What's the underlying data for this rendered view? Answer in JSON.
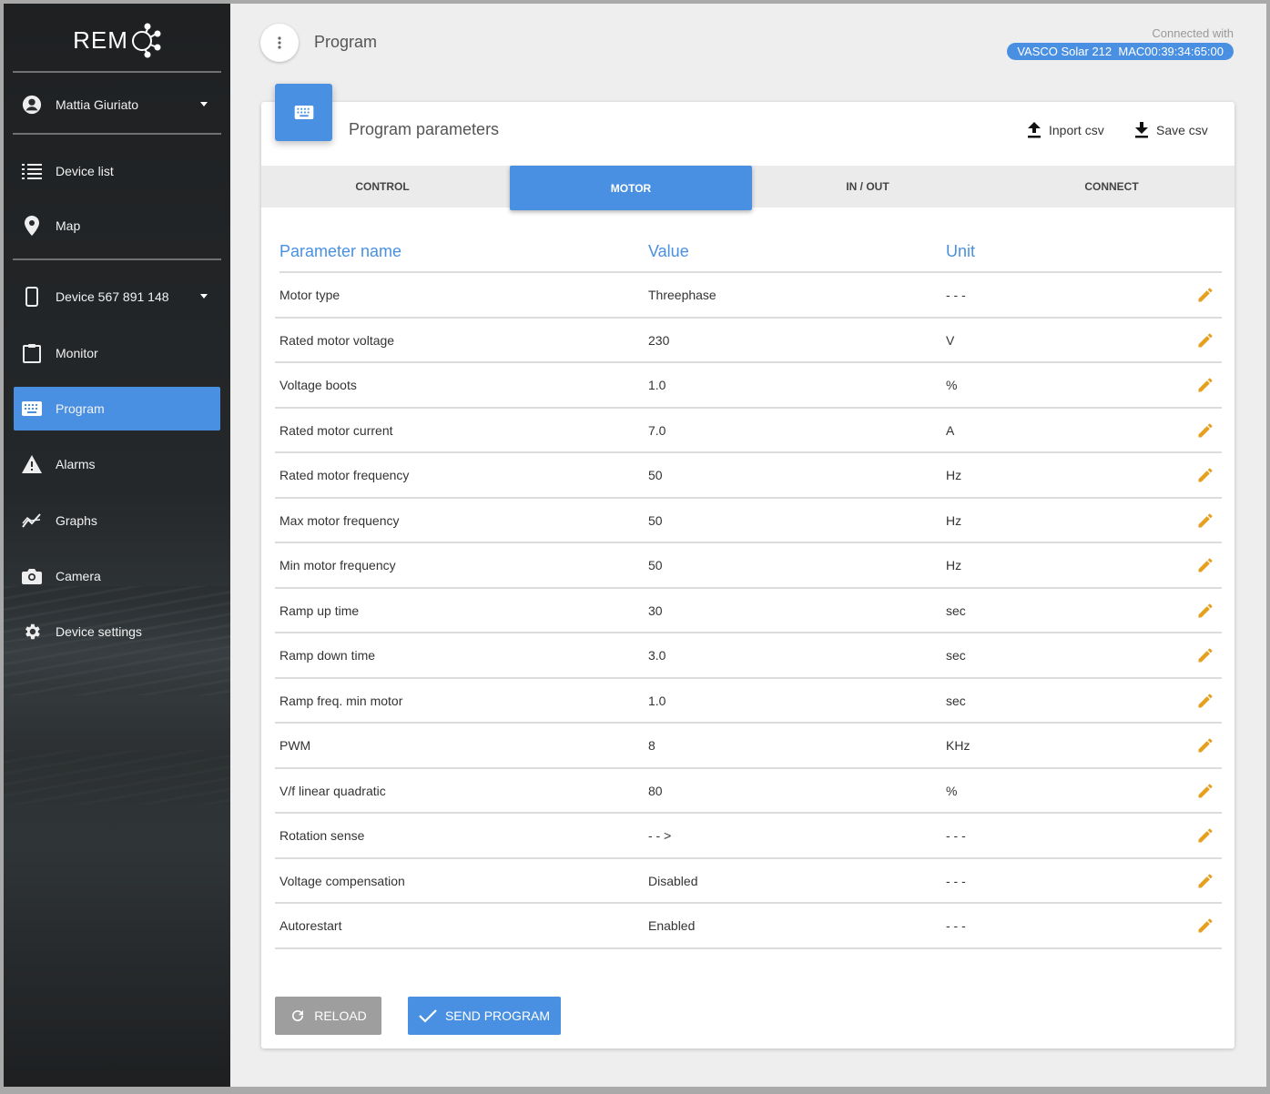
{
  "app": {
    "logo_text": "REM"
  },
  "sidebar": {
    "user": "Mattia Giuriato",
    "items": [
      {
        "label": "Device list"
      },
      {
        "label": "Map"
      },
      {
        "label": "Device 567 891 148"
      },
      {
        "label": "Monitor"
      },
      {
        "label": "Program"
      },
      {
        "label": "Alarms"
      },
      {
        "label": "Graphs"
      },
      {
        "label": "Camera"
      },
      {
        "label": "Device settings"
      }
    ]
  },
  "header": {
    "title": "Program",
    "connected_label": "Connected with",
    "connected_device": "VASCO Solar 212  MAC00:39:34:65:00"
  },
  "card": {
    "title": "Program parameters",
    "import_label": "Inport csv",
    "save_label": "Save csv",
    "tabs": [
      "CONTROL",
      "MOTOR",
      "IN / OUT",
      "CONNECT"
    ],
    "active_tab": "MOTOR",
    "columns": {
      "name": "Parameter name",
      "value": "Value",
      "unit": "Unit"
    },
    "rows": [
      {
        "name": "Motor type",
        "value": "Threephase",
        "unit": "- - -"
      },
      {
        "name": "Rated motor voltage",
        "value": "230",
        "unit": "V"
      },
      {
        "name": "Voltage boots",
        "value": "1.0",
        "unit": "%"
      },
      {
        "name": "Rated motor current",
        "value": "7.0",
        "unit": "A"
      },
      {
        "name": "Rated motor frequency",
        "value": "50",
        "unit": "Hz"
      },
      {
        "name": "Max motor frequency",
        "value": "50",
        "unit": "Hz"
      },
      {
        "name": "Min motor frequency",
        "value": "50",
        "unit": "Hz"
      },
      {
        "name": "Ramp up time",
        "value": "30",
        "unit": "sec"
      },
      {
        "name": "Ramp down time",
        "value": "3.0",
        "unit": "sec"
      },
      {
        "name": "Ramp freq. min motor",
        "value": "1.0",
        "unit": "sec"
      },
      {
        "name": "PWM",
        "value": "8",
        "unit": "KHz"
      },
      {
        "name": "V/f linear quadratic",
        "value": "80",
        "unit": "%"
      },
      {
        "name": "Rotation sense",
        "value": "- - >",
        "unit": "- - -"
      },
      {
        "name": "Voltage compensation",
        "value": "Disabled",
        "unit": "- - -"
      },
      {
        "name": "Autorestart",
        "value": "Enabled",
        "unit": "- - -"
      }
    ],
    "reload_label": "RELOAD",
    "send_label": "SEND PROGRAM"
  },
  "colors": {
    "accent": "#4a90e2",
    "edit": "#e6a020",
    "button_grey": "#9e9e9e"
  }
}
